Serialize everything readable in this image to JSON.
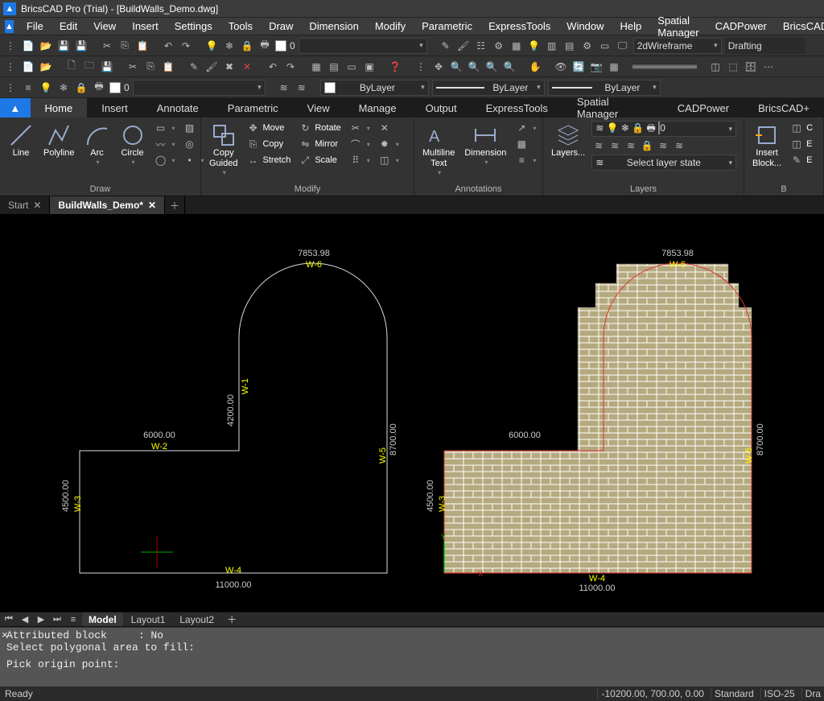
{
  "title": {
    "app": "BricsCAD Pro (Trial) - [BuildWalls_Demo.dwg]"
  },
  "menu": [
    "File",
    "Edit",
    "View",
    "Insert",
    "Settings",
    "Tools",
    "Draw",
    "Dimension",
    "Modify",
    "Parametric",
    "ExpressTools",
    "Window",
    "Help",
    "Spatial Manager",
    "CADPower",
    "BricsCAD+"
  ],
  "toolbar1": {
    "colorIndex": "0",
    "visualStyle": "2dWireframe",
    "workspace": "Drafting"
  },
  "toolbar3": {
    "layerIndex": "0",
    "bylayer1": "ByLayer",
    "bylayer2": "ByLayer",
    "bylayer3": "ByLayer"
  },
  "ribbonTabs": [
    "Home",
    "Insert",
    "Annotate",
    "Parametric",
    "View",
    "Manage",
    "Output",
    "ExpressTools",
    "Spatial Manager",
    "CADPower",
    "BricsCAD+"
  ],
  "ribbonActive": "Home",
  "ribbon": {
    "draw": {
      "title": "Draw",
      "line": "Line",
      "polyline": "Polyline",
      "arc": "Arc",
      "circle": "Circle"
    },
    "modify": {
      "title": "Modify",
      "copyguided": "Copy\nGuided",
      "move": "Move",
      "copy": "Copy",
      "stretch": "Stretch",
      "rotate": "Rotate",
      "mirror": "Mirror",
      "scale": "Scale"
    },
    "annotations": {
      "title": "Annotations",
      "multiline": "Multiline\nText",
      "dimension": "Dimension"
    },
    "layers": {
      "title": "Layers",
      "layersBtn": "Layers...",
      "index": "0",
      "selectState": "Select layer state"
    },
    "block": {
      "title": "B",
      "insert": "Insert\nBlock..."
    }
  },
  "docTabs": {
    "start": "Start",
    "file": "BuildWalls_Demo*"
  },
  "layoutTabs": [
    "Model",
    "Layout1",
    "Layout2"
  ],
  "layoutActive": "Model",
  "cmd": {
    "line1": "Attributed block     : No",
    "line2": "Select polygonal area to fill:",
    "prompt": "Pick origin point:"
  },
  "status": {
    "ready": "Ready",
    "coords": "-10200.00, 700.00, 0.00",
    "std": "Standard",
    "dimstyle": "ISO-25",
    "misc": "Dra"
  },
  "canvas": {
    "left": {
      "arcLen": "7853.98",
      "h4200": "4200.00",
      "w6000": "6000.00",
      "h4500": "4500.00",
      "w11000": "11000.00",
      "h8700": "8700.00",
      "w1": "W-1",
      "w2": "W-2",
      "w3": "W-3",
      "w4": "W-4",
      "w5": "W-5",
      "w6": "W-6"
    },
    "right": {
      "arcLen": "7853.98",
      "h4200": "",
      "w6000": "6000.00",
      "h4500": "4500.00",
      "w11000": "11000.00",
      "h8700": "8700.00",
      "w3": "W-3",
      "w4": "W-4",
      "w5": "W-5",
      "w6": "W-6"
    }
  }
}
